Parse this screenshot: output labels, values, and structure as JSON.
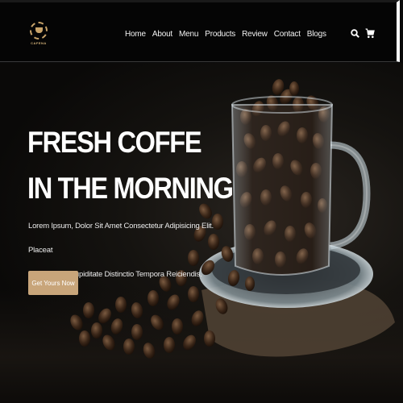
{
  "brand": {
    "logo_text": "CAFENA"
  },
  "nav": {
    "items": [
      "Home",
      "About",
      "Menu",
      "Products",
      "Review",
      "Contact",
      "Blogs"
    ],
    "icons": [
      "search-icon",
      "cart-icon"
    ]
  },
  "hero": {
    "title_line1": "FRESH COFFE",
    "title_line2": "IN THE MORNING",
    "desc_line1": "Lorem Ipsum, Dolor Sit Amet Consectetur Adipisicing Elit. Placeat",
    "desc_line2": "Labore, Sint Cupiditate Distinctio Tempora Reiciendis.",
    "cta_label": "Get Yours Now"
  },
  "colors": {
    "accent": "#c8a57a",
    "background": "#0a0a0a",
    "text": "#ffffff"
  }
}
